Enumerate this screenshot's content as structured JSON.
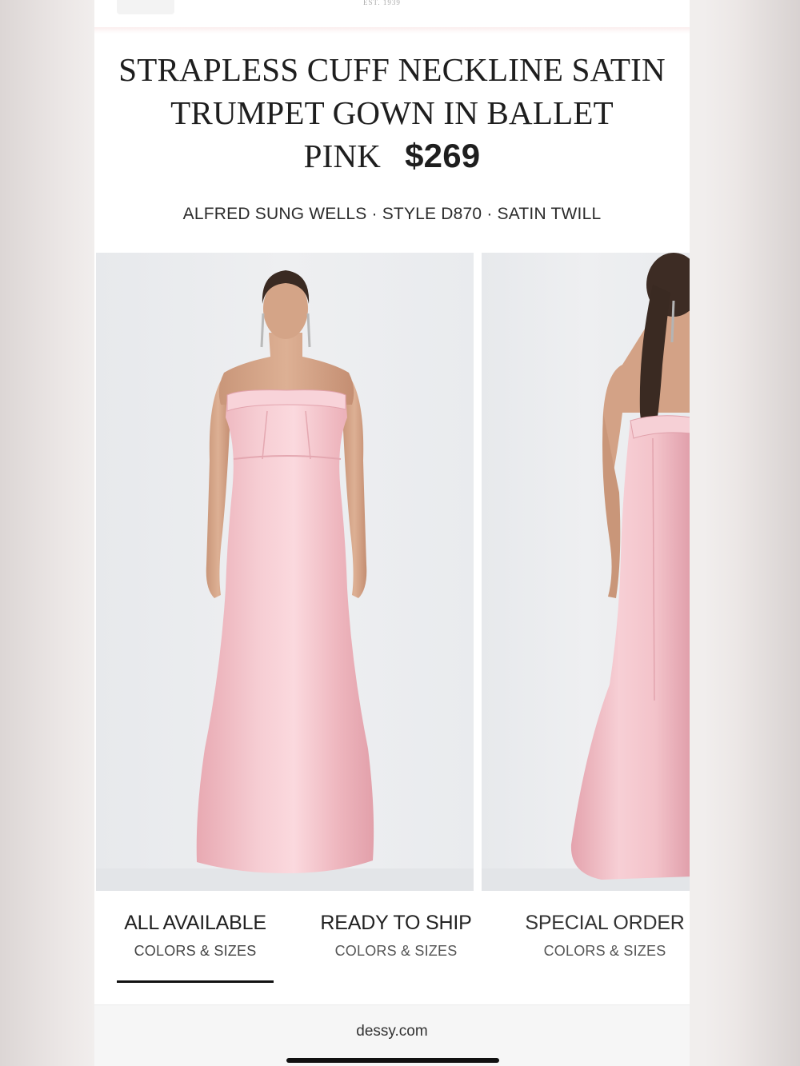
{
  "header": {
    "established": "EST. 1939"
  },
  "product": {
    "title_line1": "STRAPLESS CUFF NECKLINE SATIN",
    "title_line2": "TRUMPET GOWN IN BALLET",
    "title_line3": "PINK",
    "price": "$269",
    "meta": "ALFRED SUNG WELLS · STYLE D870 · SATIN TWILL",
    "dress_color": "#efb9c0"
  },
  "tabs": [
    {
      "label": "ALL AVAILABLE",
      "sub": "COLORS & SIZES",
      "active": true
    },
    {
      "label": "READY TO SHIP",
      "sub": "COLORS & SIZES",
      "active": false
    },
    {
      "label": "SPECIAL ORDER",
      "sub": "COLORS & SIZES",
      "active": false
    }
  ],
  "footer": {
    "url": "dessy.com"
  }
}
